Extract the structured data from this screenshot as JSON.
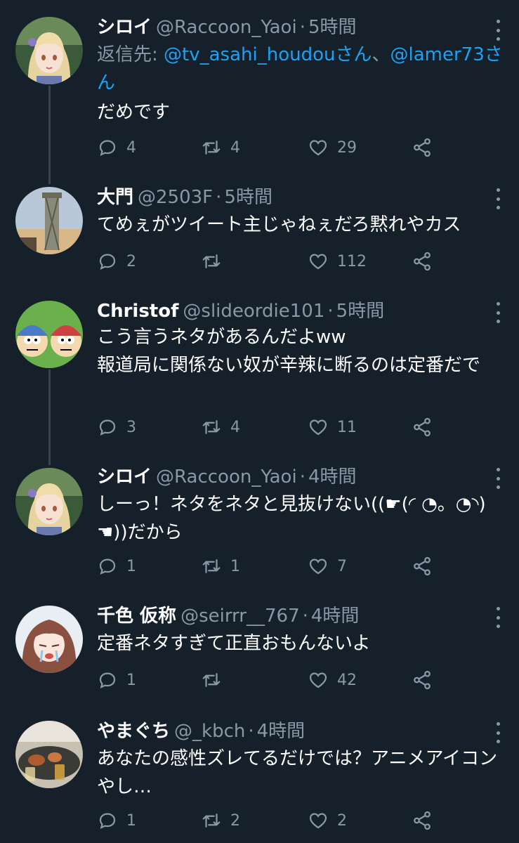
{
  "tweets": [
    {
      "name": "シロイ",
      "handle": "@Raccoon_Yaoi",
      "separator": "·",
      "time": "5時間",
      "reply_to_label": "返信先: ",
      "reply_to_mention1": "@tv_asahi_houdouさん",
      "reply_to_sep": "、",
      "reply_to_mention2": "@lamer73さん",
      "text": "だめです",
      "replies": "4",
      "retweets": "4",
      "likes": "29",
      "avatar": "anime-girl-blonde-avatar"
    },
    {
      "name": "大門",
      "handle": "@2503F",
      "separator": "·",
      "time": "5時間",
      "text": "てめぇがツイート主じゃねぇだろ黙れやカス",
      "replies": "2",
      "retweets": "",
      "likes": "112",
      "avatar": "tower-photo-avatar"
    },
    {
      "name": "Christof",
      "handle": "@slideordie101",
      "separator": "·",
      "time": "5時間",
      "text": "こう言うネタがあるんだよww\n報道局に関係ない奴が辛辣に断るのは定番だで",
      "replies": "3",
      "retweets": "4",
      "likes": "11",
      "avatar": "cartoon-characters-avatar"
    },
    {
      "name": "シロイ",
      "handle": "@Raccoon_Yaoi",
      "separator": "·",
      "time": "4時間",
      "text": "しーっ！ネタをネタと見抜けない((☛(◜ ◔。◔◝)☚))だから",
      "replies": "1",
      "retweets": "1",
      "likes": "7",
      "avatar": "anime-girl-blonde-avatar"
    },
    {
      "name": "千色 仮称",
      "handle": "@seirrr__767",
      "separator": "·",
      "time": "4時間",
      "text": "定番ネタすぎて正直おもんないよ",
      "replies": "1",
      "retweets": "",
      "likes": "42",
      "avatar": "anime-girl-crying-avatar"
    },
    {
      "name": "やまぐち",
      "handle": "@_kbch",
      "separator": "·",
      "time": "4時間",
      "text": "あなたの感性ズレてるだけでは？アニメアイコンやし…",
      "replies": "1",
      "retweets": "2",
      "likes": "2",
      "avatar": "food-photo-avatar"
    }
  ],
  "colors": {
    "background": "#15202b",
    "text": "#ffffff",
    "secondary": "#8899a6",
    "link": "#1da1f2",
    "thread_line": "#38444d"
  }
}
